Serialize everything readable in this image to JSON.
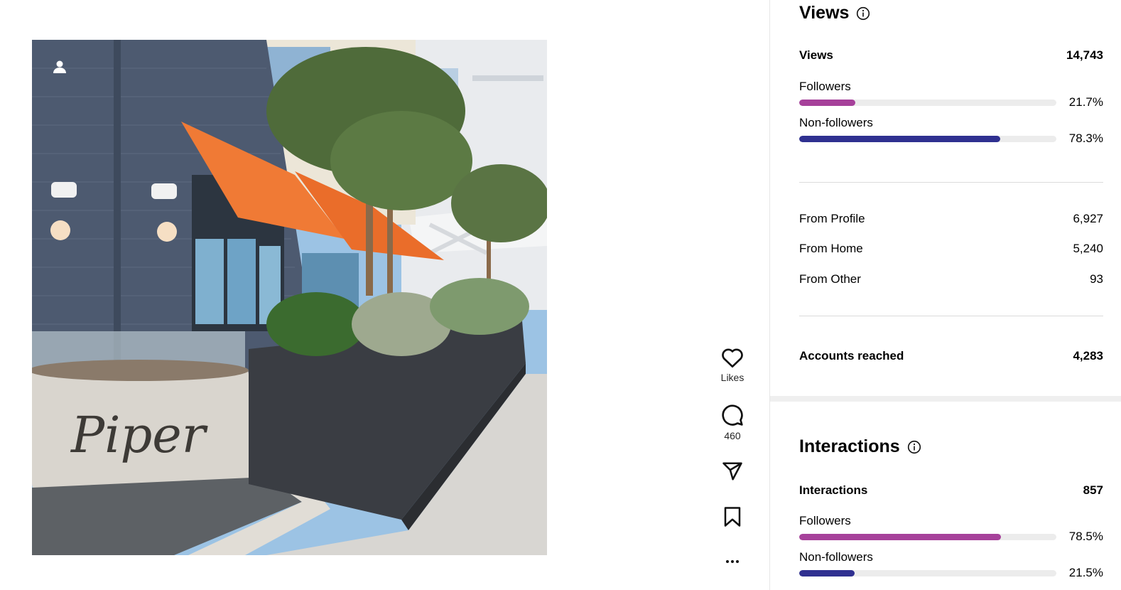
{
  "post": {
    "image_alt": "Piper restaurant exterior with orange awnings, trees and a planter"
  },
  "actions": {
    "likes_label": "Likes",
    "comments_count": "460"
  },
  "views": {
    "title": "Views",
    "total_label": "Views",
    "total_value": "14,743",
    "followers_label": "Followers",
    "followers_pct": "21.7%",
    "followers_fraction": 0.217,
    "nonfollowers_label": "Non-followers",
    "nonfollowers_pct": "78.3%",
    "nonfollowers_fraction": 0.783,
    "sources": [
      {
        "label": "From Profile",
        "value": "6,927"
      },
      {
        "label": "From Home",
        "value": "5,240"
      },
      {
        "label": "From Other",
        "value": "93"
      }
    ],
    "reached_label": "Accounts reached",
    "reached_value": "4,283"
  },
  "interactions": {
    "title": "Interactions",
    "total_label": "Interactions",
    "total_value": "857",
    "followers_label": "Followers",
    "followers_pct": "78.5%",
    "followers_fraction": 0.785,
    "nonfollowers_label": "Non-followers",
    "nonfollowers_pct": "21.5%",
    "nonfollowers_fraction": 0.215
  },
  "colors": {
    "followers": "#a6419a",
    "nonfollowers": "#2f3090"
  }
}
